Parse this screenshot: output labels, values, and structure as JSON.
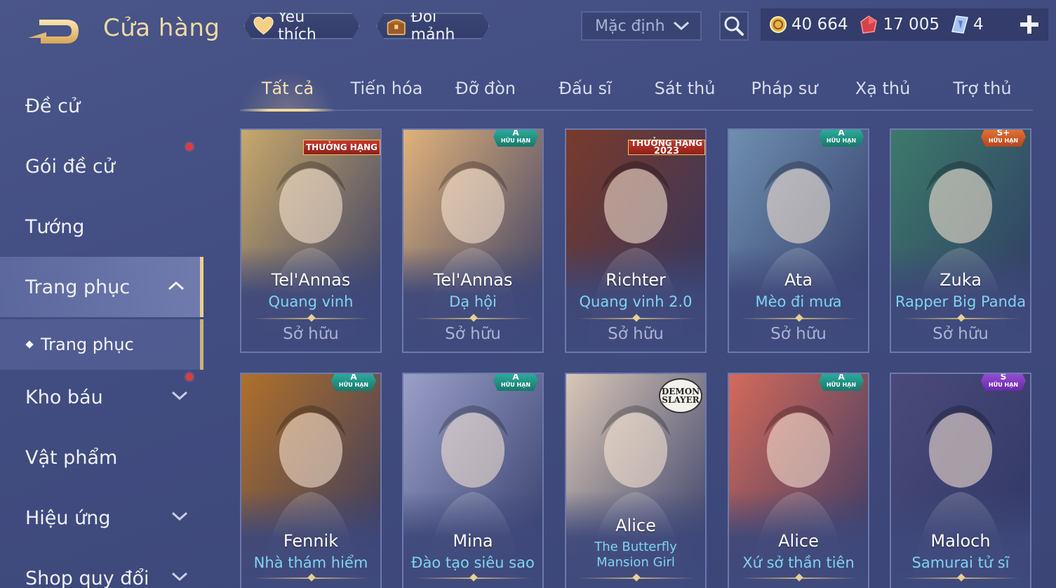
{
  "header": {
    "title": "Cửa hàng",
    "favorite_label": "Yêu thích",
    "exchange_label": "Đổi mảnh",
    "sort_value": "Mặc định"
  },
  "currencies": {
    "gold": "40 664",
    "vouchers": "17 005",
    "diamonds": "4"
  },
  "sidebar": {
    "items": [
      {
        "label": "Đề cử"
      },
      {
        "label": "Gói đề cử"
      },
      {
        "label": "Tướng"
      },
      {
        "label": "Trang phục"
      },
      {
        "label": "Kho báu"
      },
      {
        "label": "Vật phẩm"
      },
      {
        "label": "Hiệu ứng"
      },
      {
        "label": "Shop quy đổi"
      }
    ],
    "sub_item": "Trang phục"
  },
  "tabs": [
    {
      "label": "Tất cả"
    },
    {
      "label": "Tiến hóa"
    },
    {
      "label": "Đỡ đòn"
    },
    {
      "label": "Đấu sĩ"
    },
    {
      "label": "Sát thủ"
    },
    {
      "label": "Pháp sư"
    },
    {
      "label": "Xạ thủ"
    },
    {
      "label": "Trợ thủ"
    }
  ],
  "cards": [
    {
      "hero": "Tel'Annas",
      "skin": "Quang vinh",
      "status": "Sở hữu",
      "badge_top": "THƯỞNG HẠNG",
      "badge_sub": "",
      "color": "#c8a86a"
    },
    {
      "hero": "Tel'Annas",
      "skin": "Dạ hội",
      "status": "Sở hữu",
      "badge_top": "A",
      "badge_sub": "HỮU HẠN",
      "color": "#e0b27a"
    },
    {
      "hero": "Richter",
      "skin": "Quang vinh 2.0",
      "status": "Sở hữu",
      "badge_top": "THƯỞNG HẠNG",
      "badge_sub": "2023",
      "color": "#7a3a2a"
    },
    {
      "hero": "Ata",
      "skin": "Mèo đi mưa",
      "status": "Sở hữu",
      "badge_top": "A",
      "badge_sub": "HỮU HẠN",
      "color": "#6f8fb0"
    },
    {
      "hero": "Zuka",
      "skin": "Rapper Big Panda",
      "status": "Sở hữu",
      "badge_top": "S+",
      "badge_sub": "HỮU HẠN",
      "color": "#3d7a6a"
    },
    {
      "hero": "Fennik",
      "skin": "Nhà thám hiểm",
      "status": "",
      "badge_top": "A",
      "badge_sub": "HỮU HẠN",
      "color": "#b0702a"
    },
    {
      "hero": "Mina",
      "skin": "Đào tạo siêu sao",
      "status": "",
      "badge_top": "A",
      "badge_sub": "HỮU HẠN",
      "color": "#9aa0c8"
    },
    {
      "hero": "Alice",
      "skin": "The Butterfly Mansion Girl",
      "status": "",
      "badge_top": "",
      "badge_sub": "",
      "color": "#d9c7b6"
    },
    {
      "hero": "Alice",
      "skin": "Xứ sở thần tiên",
      "status": "",
      "badge_top": "A",
      "badge_sub": "HỮU HẠN",
      "color": "#d46a5a"
    },
    {
      "hero": "Maloch",
      "skin": "Samurai tử sĩ",
      "status": "",
      "badge_top": "S",
      "badge_sub": "HỮU HẠN",
      "color": "#4a4a7a"
    }
  ],
  "demon_logo": {
    "line1": "DEMON",
    "line2": "SLAYER"
  }
}
